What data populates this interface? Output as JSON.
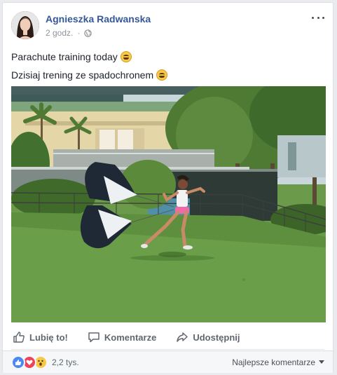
{
  "post": {
    "author": "Agnieszka Radwanska",
    "time": "2 godz.",
    "privacy_icon": "globe-icon",
    "text_lines": [
      "Parachute training today",
      "Dzisiaj trening ze spadochronem"
    ]
  },
  "actions": {
    "like": "Lubię to!",
    "comment": "Komentarze",
    "share": "Udostępnij"
  },
  "footer": {
    "reaction_icons": [
      "like-reaction-icon",
      "love-reaction-icon",
      "wow-reaction-icon"
    ],
    "reaction_count": "2,2 tys.",
    "sort_label": "Najlepsze komentarze"
  },
  "colors": {
    "author_link": "#365899",
    "action_text": "#606770",
    "like_blue": "#4a89f3",
    "love_red": "#f0425b",
    "wow_yellow": "#f7c84a"
  }
}
